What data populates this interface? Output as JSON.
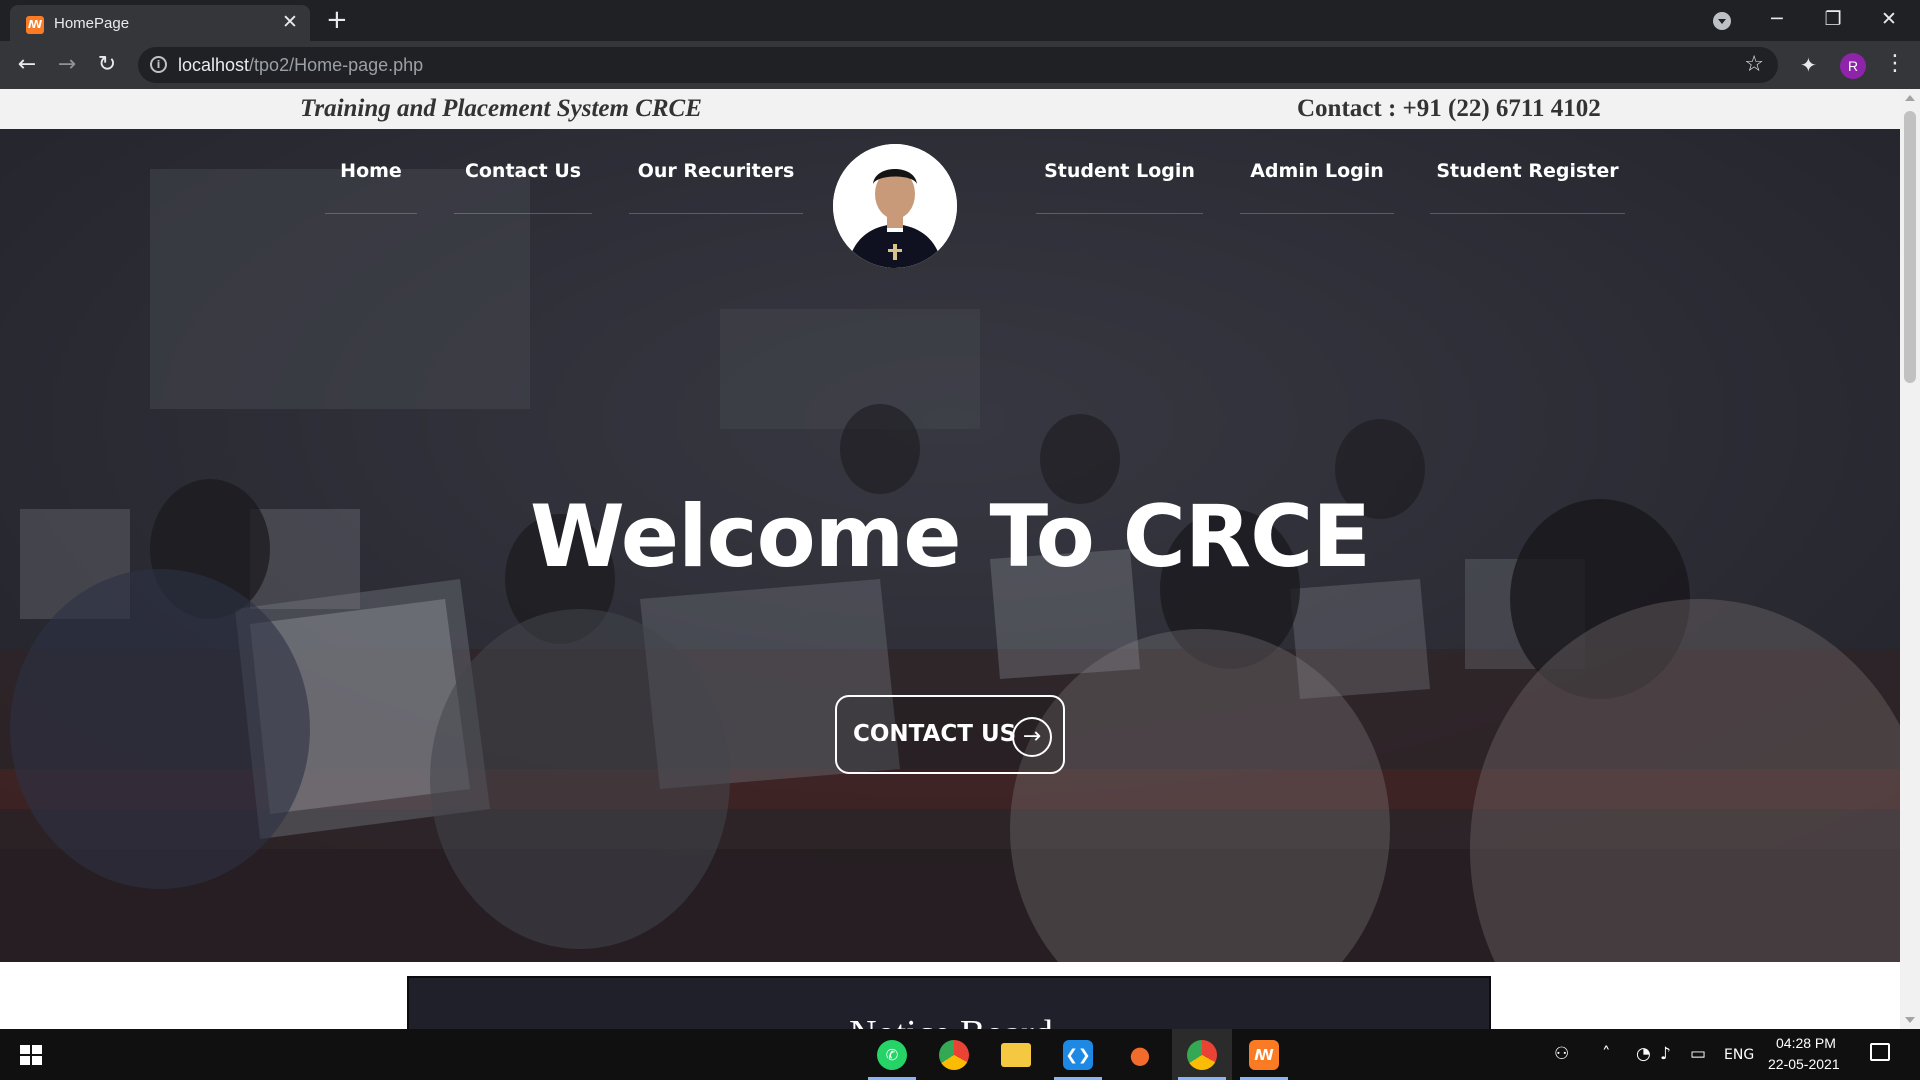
{
  "browser": {
    "tab_title": "HomePage",
    "tab_close": "✕",
    "new_tab": "+",
    "url_host": "localhost",
    "url_path": "/tpo2/Home-page.php",
    "profile_initial": "R",
    "window_controls": [
      "─",
      "❐",
      "✕"
    ]
  },
  "page": {
    "header_title": "Training and Placement System CRCE",
    "header_contact": "Contact : +91 (22) 6711 4102",
    "nav": [
      {
        "label": "Home"
      },
      {
        "label": "Contact Us"
      },
      {
        "label": "Our Recuriters"
      },
      {
        "label": "Student Login"
      },
      {
        "label": "Admin Login"
      },
      {
        "label": "Student Register"
      }
    ],
    "hero_title": "Welcome To CRCE",
    "hero_button": "CONTACT US",
    "notice_title": "Notice Board"
  },
  "taskbar": {
    "lang": "ENG",
    "time": "04:28 PM",
    "date": "22-05-2021",
    "apps": [
      "whatsapp-icon",
      "chrome-icon",
      "file-explorer-icon",
      "vscode-icon",
      "microphone-icon",
      "chrome-icon",
      "xampp-icon"
    ]
  },
  "colors": {
    "chrome_dark": "#202124",
    "chrome_toolbar": "#35363a",
    "topbar_bg": "#f2f2f2",
    "notice_bg": "#1f2029",
    "xampp_orange": "#fb7a24"
  }
}
